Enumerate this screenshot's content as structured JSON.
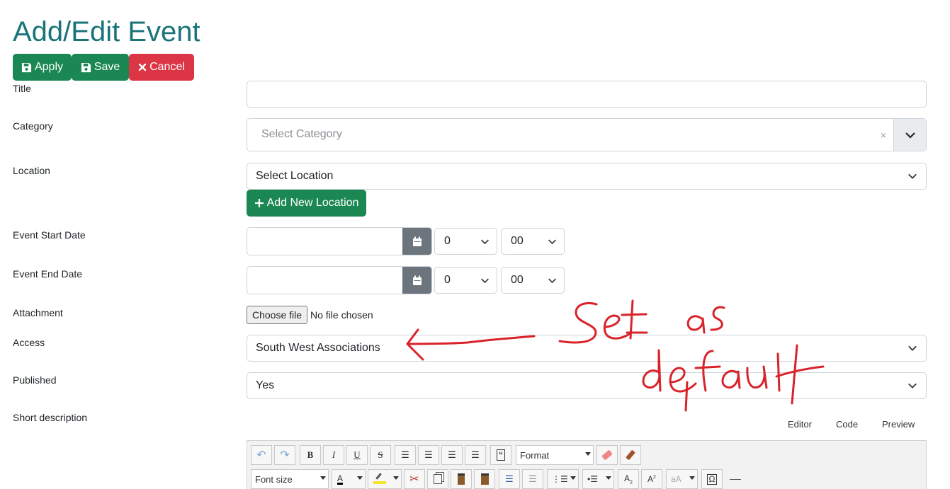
{
  "page": {
    "title": "Add/Edit Event"
  },
  "actions": {
    "apply_label": "Apply",
    "save_label": "Save",
    "cancel_label": "Cancel"
  },
  "form": {
    "title_label": "Title",
    "title_value": "",
    "category_label": "Category",
    "category_placeholder": "Select Category",
    "category_clear": "×",
    "location_label": "Location",
    "location_value": "Select Location",
    "add_location_label": "Add New Location",
    "start_date_label": "Event Start Date",
    "start_hour": "0",
    "start_minute": "00",
    "end_date_label": "Event End Date",
    "end_hour": "0",
    "end_minute": "00",
    "attachment_label": "Attachment",
    "choose_file_label": "Choose file",
    "no_file_text": "No file chosen",
    "access_label": "Access",
    "access_value": "South West Associations",
    "published_label": "Published",
    "published_value": "Yes",
    "short_description_label": "Short description"
  },
  "editor": {
    "tabs": [
      "Editor",
      "Code",
      "Preview"
    ],
    "format_label": "Format",
    "font_size_label": "Font size",
    "toolbar_icons": [
      "undo-icon",
      "redo-icon",
      "bold-icon",
      "italic-icon",
      "underline-icon",
      "strikethrough-icon",
      "justify-icon",
      "align-center-icon",
      "align-left-icon",
      "align-right-icon",
      "blockquote-icon",
      "eraser-icon",
      "broom-icon",
      "text-color-icon",
      "highlight-icon",
      "cut-icon",
      "copy-icon",
      "paste-icon",
      "paste-text-icon",
      "indent-icon",
      "outdent-icon",
      "numbered-list-icon",
      "bullet-list-icon",
      "subscript-icon",
      "superscript-icon",
      "font-case-icon",
      "omega-icon",
      "horizontal-rule-icon"
    ]
  },
  "colors": {
    "title": "#1a7479",
    "success": "#1b8752",
    "danger": "#dc3545",
    "annotation": "#d9232a"
  }
}
